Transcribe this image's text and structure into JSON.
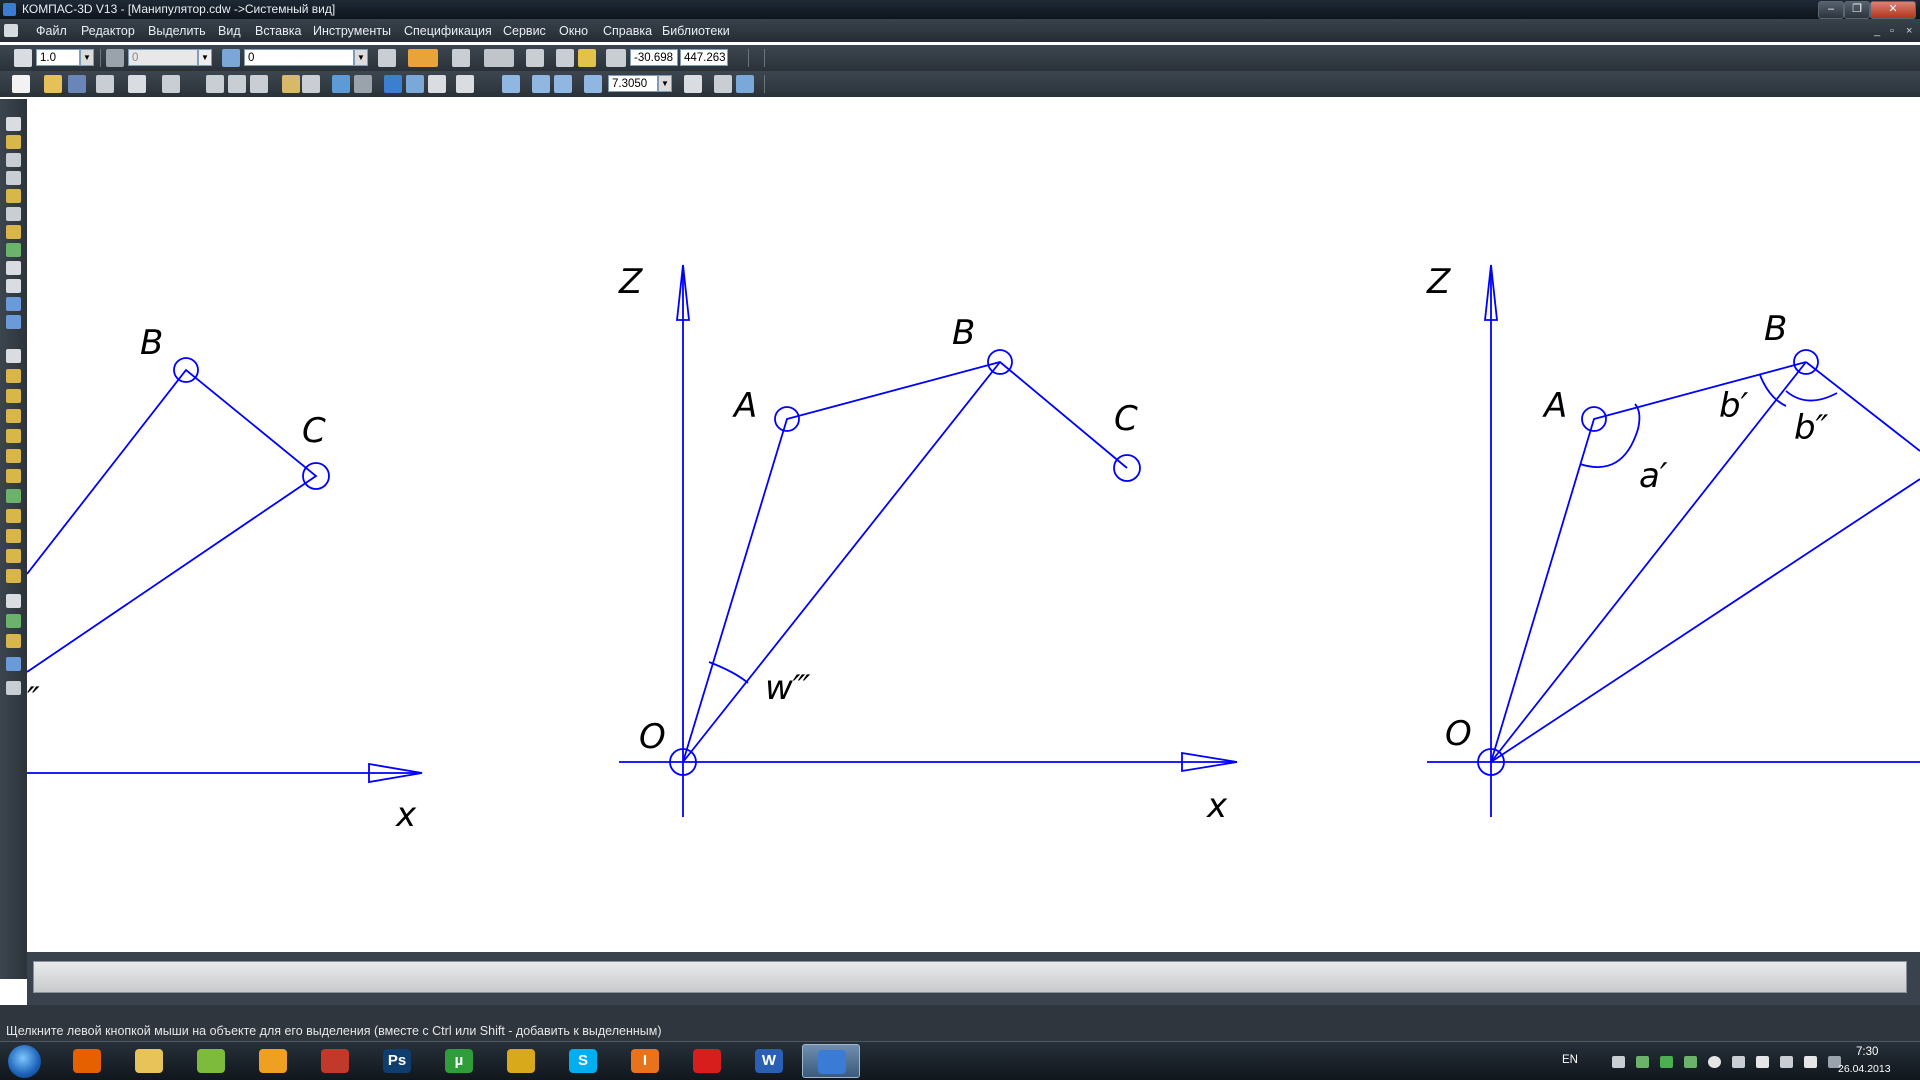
{
  "window": {
    "title": "КОМПАС-3D V13 - [Манипулятор.cdw ->Системный вид]",
    "buttons": {
      "minimize": "–",
      "maximize": "❐",
      "close": "✕"
    }
  },
  "menu": {
    "items": [
      "Файл",
      "Редактор",
      "Выделить",
      "Вид",
      "Вставка",
      "Инструменты",
      "Спецификация",
      "Сервис",
      "Окно",
      "Справка",
      "Библиотеки"
    ],
    "mdi": {
      "minimize": "_",
      "restore": "▫",
      "close": "×"
    }
  },
  "toolbar_top": {
    "scale": "1.0",
    "style": "0",
    "layer": "0",
    "coord_x": "-30.698",
    "coord_y": "447.263"
  },
  "toolbar_bottom": {
    "zoom": "7.3050"
  },
  "drawing": {
    "color": "#0000ff",
    "diagrams": [
      {
        "labels": {
          "B": "B",
          "C": "C",
          "x": "x",
          "angle_mark": "″"
        }
      },
      {
        "labels": {
          "Z": "Z",
          "A": "A",
          "B": "B",
          "C": "C",
          "O": "O",
          "x": "x",
          "angle": "w‴"
        }
      },
      {
        "labels": {
          "Z": "Z",
          "A": "A",
          "B": "B",
          "O": "O",
          "a": "a′",
          "b1": "b′",
          "b2": "b″"
        }
      }
    ]
  },
  "status": {
    "message": "Щелкните левой кнопкой мыши на объекте для его выделения (вместе с Ctrl или Shift - добавить к выделенным)"
  },
  "taskbar": {
    "apps": [
      {
        "name": "firefox",
        "glyph": "",
        "color": "#e66000"
      },
      {
        "name": "explorer",
        "glyph": "",
        "color": "#e8c35a"
      },
      {
        "name": "recycle",
        "glyph": "",
        "color": "#7dbb3c"
      },
      {
        "name": "swirl",
        "glyph": "",
        "color": "#f0a020"
      },
      {
        "name": "pin",
        "glyph": "",
        "color": "#c0392b"
      },
      {
        "name": "photoshop",
        "glyph": "Ps",
        "color": "#0f3d6e"
      },
      {
        "name": "utorrent",
        "glyph": "µ",
        "color": "#2e9d3a"
      },
      {
        "name": "chrome",
        "glyph": "",
        "color": "#d9a91c"
      },
      {
        "name": "skype",
        "glyph": "S",
        "color": "#00aff0"
      },
      {
        "name": "i-app",
        "glyph": "I",
        "color": "#e8731c"
      },
      {
        "name": "splat",
        "glyph": "",
        "color": "#d81d1d"
      },
      {
        "name": "word",
        "glyph": "W",
        "color": "#2b5fb4"
      },
      {
        "name": "kompas",
        "glyph": "",
        "color": "#3a7bd5"
      }
    ],
    "language": "EN",
    "time": "7:30",
    "date": "26.04.2013"
  }
}
